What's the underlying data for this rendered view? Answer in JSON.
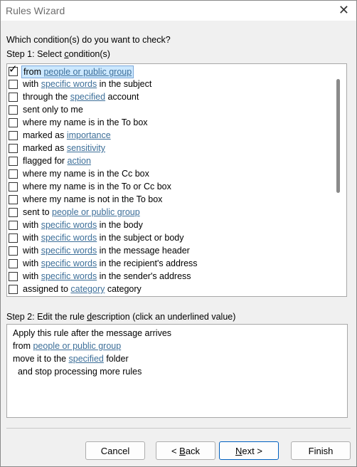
{
  "window": {
    "title": "Rules Wizard",
    "close_glyph": "✕"
  },
  "question": "Which condition(s) do you want to check?",
  "step1": {
    "pre": "Step 1: Select ",
    "ul": "c",
    "post": "ondition(s)"
  },
  "conditions": [
    {
      "checked": true,
      "parts": [
        {
          "t": "from "
        },
        {
          "t": "people or public group",
          "link": true
        }
      ]
    },
    {
      "checked": false,
      "parts": [
        {
          "t": "with "
        },
        {
          "t": "specific words",
          "link": true
        },
        {
          "t": " in the subject"
        }
      ]
    },
    {
      "checked": false,
      "parts": [
        {
          "t": "through the "
        },
        {
          "t": "specified",
          "link": true
        },
        {
          "t": " account"
        }
      ]
    },
    {
      "checked": false,
      "parts": [
        {
          "t": "sent only to me"
        }
      ]
    },
    {
      "checked": false,
      "parts": [
        {
          "t": "where my name is in the To box"
        }
      ]
    },
    {
      "checked": false,
      "parts": [
        {
          "t": "marked as "
        },
        {
          "t": "importance",
          "link": true
        }
      ]
    },
    {
      "checked": false,
      "parts": [
        {
          "t": "marked as "
        },
        {
          "t": "sensitivity",
          "link": true
        }
      ]
    },
    {
      "checked": false,
      "parts": [
        {
          "t": "flagged for "
        },
        {
          "t": "action",
          "link": true
        }
      ]
    },
    {
      "checked": false,
      "parts": [
        {
          "t": "where my name is in the Cc box"
        }
      ]
    },
    {
      "checked": false,
      "parts": [
        {
          "t": "where my name is in the To or Cc box"
        }
      ]
    },
    {
      "checked": false,
      "parts": [
        {
          "t": "where my name is not in the To box"
        }
      ]
    },
    {
      "checked": false,
      "parts": [
        {
          "t": "sent to "
        },
        {
          "t": "people or public group",
          "link": true
        }
      ]
    },
    {
      "checked": false,
      "parts": [
        {
          "t": "with "
        },
        {
          "t": "specific words",
          "link": true
        },
        {
          "t": " in the body"
        }
      ]
    },
    {
      "checked": false,
      "parts": [
        {
          "t": "with "
        },
        {
          "t": "specific words",
          "link": true
        },
        {
          "t": " in the subject or body"
        }
      ]
    },
    {
      "checked": false,
      "parts": [
        {
          "t": "with "
        },
        {
          "t": "specific words",
          "link": true
        },
        {
          "t": " in the message header"
        }
      ]
    },
    {
      "checked": false,
      "parts": [
        {
          "t": "with "
        },
        {
          "t": "specific words",
          "link": true
        },
        {
          "t": " in the recipient's address"
        }
      ]
    },
    {
      "checked": false,
      "parts": [
        {
          "t": "with "
        },
        {
          "t": "specific words",
          "link": true
        },
        {
          "t": " in the sender's address"
        }
      ]
    },
    {
      "checked": false,
      "parts": [
        {
          "t": "assigned to "
        },
        {
          "t": "category",
          "link": true
        },
        {
          "t": " category"
        }
      ]
    }
  ],
  "step2": {
    "pre": "Step 2: Edit the rule ",
    "ul": "d",
    "post": "escription (click an underlined value)"
  },
  "description": [
    {
      "parts": [
        {
          "t": "Apply this rule after the message arrives"
        }
      ]
    },
    {
      "parts": [
        {
          "t": "from "
        },
        {
          "t": "people or public group",
          "link": true
        }
      ]
    },
    {
      "parts": [
        {
          "t": "move it to the "
        },
        {
          "t": "specified",
          "link": true
        },
        {
          "t": " folder"
        }
      ]
    },
    {
      "parts": [
        {
          "t": "  and stop processing more rules"
        }
      ]
    }
  ],
  "buttons": {
    "cancel": "Cancel",
    "back": {
      "pre": "< ",
      "ul": "B",
      "post": "ack"
    },
    "next": {
      "pre": "",
      "ul": "N",
      "post": "ext >"
    },
    "finish": "Finish"
  }
}
